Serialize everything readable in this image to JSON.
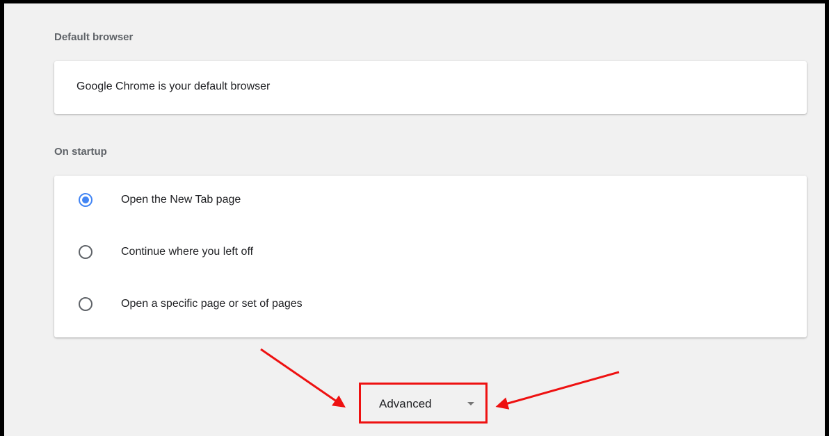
{
  "default_browser": {
    "title": "Default browser",
    "status_text": "Google Chrome is your default browser"
  },
  "on_startup": {
    "title": "On startup",
    "options": [
      {
        "label": "Open the New Tab page",
        "selected": true
      },
      {
        "label": "Continue where you left off",
        "selected": false
      },
      {
        "label": "Open a specific page or set of pages",
        "selected": false
      }
    ]
  },
  "advanced": {
    "label": "Advanced",
    "icon": "chevron-down-icon"
  },
  "colors": {
    "accent": "#4285f4",
    "annotation": "#ee1111",
    "background": "#f1f1f1"
  }
}
